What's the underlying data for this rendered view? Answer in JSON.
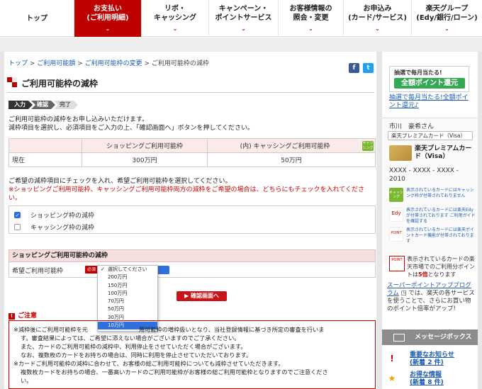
{
  "nav": {
    "items": [
      {
        "label": "トップ",
        "active": false
      },
      {
        "label": "お支払い\n(ご利用明細)",
        "active": true
      },
      {
        "label": "リボ・\nキャッシング",
        "active": false
      },
      {
        "label": "キャンペーン・\nポイントサービス",
        "active": false
      },
      {
        "label": "お客様情報の\n照会・変更",
        "active": false
      },
      {
        "label": "お申込み\n(カード/サービス)",
        "active": false
      },
      {
        "label": "楽天グループ\n(Edy/銀行/ローン)",
        "active": false
      }
    ],
    "nav_label_0": "トップ",
    "nav_label_1a": "お支払い",
    "nav_label_1b": "(ご利用明細)",
    "nav_label_2a": "リボ・",
    "nav_label_2b": "キャッシング",
    "nav_label_3a": "キャンペーン・",
    "nav_label_3b": "ポイントサービス",
    "nav_label_4a": "お客様情報の",
    "nav_label_4b": "照会・変更",
    "nav_label_5a": "お申込み",
    "nav_label_5b": "(カード/サービス)",
    "nav_label_6a": "楽天グループ",
    "nav_label_6b": "(Edy/銀行/ローン)"
  },
  "breadcrumb": {
    "items": [
      "トップ",
      "ご利用可能額",
      "ご利用可能枠の変更",
      "ご利用可能枠の減枠"
    ],
    "sep": " > "
  },
  "share": {
    "facebook": "f",
    "twitter": "t"
  },
  "page_title": "ご利用可能枠の減枠",
  "steps": [
    "入力",
    "確認",
    "完了"
  ],
  "intro": {
    "line1": "ご利用可能枠の減枠をお申し込みいただけます。",
    "line2": "減枠項目を選択し、必須項目をご入力の上、「確認画面へ」ボタンを押してください。"
  },
  "limits_table": {
    "headers": [
      "",
      "ショッピングご利用可能枠",
      "(内) キャッシングご利用可能枠"
    ],
    "cash_badge": "キャッシング",
    "rows": [
      [
        "現在",
        "300万円",
        "50万円"
      ]
    ]
  },
  "note": {
    "line1": "ご希望の減枠項目にチェックを入れ、希望ご利用可能枠を選択してください。",
    "line2": "※ショッピングご利用可能枠、キャッシングご利用可能枠両方の減枠をご希望の場合は、どちらにもチェックを入れてくださ",
    "line3": "い。"
  },
  "checkboxes": [
    {
      "label": "ショッピング枠の減枠",
      "checked": true
    },
    {
      "label": "キャッシング枠の減枠",
      "checked": false
    }
  ],
  "shopping_section": {
    "heading": "ショッピングご利用可能枠の減枠",
    "field_label": "希望ご利用可能枠",
    "required": "必須"
  },
  "dropdown": {
    "options": [
      "選択してください",
      "200万円",
      "150万円",
      "100万円",
      "70万円",
      "50万円",
      "30万円",
      "10万円"
    ],
    "checked_index": 0,
    "highlighted_index": 7
  },
  "confirm_button": "確認画面へ",
  "attention": {
    "heading": "ご注意",
    "p1a": "※減枠後にご利用可能枠を元",
    "p1b": "用可能枠の増枠扱いとなり、当社登録情報に基づき所定の審査を行いま",
    "p2": "す。審査結果によっては、ご希望に添えない場合がございますのでご了承ください。",
    "p3": "また、カードのご利用可能枠の減枠中、利用停止をさせていただく場合がございます。",
    "p4": "なお、複数枚のカードをお持ちの場合は、同時に利用を停止させていただいております。",
    "p5": "※カードご利用可能枠の減枠に合わせて、お客様の総ご利用可能枠についても減枠させていただきます。",
    "p6": "複数枚カードをお持ちの場合、一番高いカードのご利用可能枠がお客様の総ご利用可能枠となりますのでご注意くださ",
    "p7": "い。"
  },
  "sidebar": {
    "banner_top": "抽選で毎月当たる!",
    "banner_main": "全額ポイント還元",
    "banner_link": "抽選で毎月当たる!全額ポイント還元♪",
    "user_name": "市川　豪希さん",
    "card_select": "楽天プレミアムカード（Visa）",
    "card_name": "楽天プレミアムカード（Visa）",
    "card_number": "XXXX - XXXX - XXXX - 2010",
    "rows": [
      {
        "icon": "キャッシング",
        "text": "表示されているカードにはキャッシング枠が付帯されておりません"
      },
      {
        "icon": "Edy",
        "text": "表示されているカードには楽天Edyが付帯されております ご利用ガイドを確認する"
      },
      {
        "icon": "POINT",
        "text": "表示されているカードには楽天ポイントカード機能が付帯されております"
      }
    ],
    "point_text_a": "表示されているカードの楽天市場でのご利用分ポイントは",
    "point_text_b": "5倍",
    "point_text_c": "となります",
    "point_icon": "POINT",
    "sp_link": "スーパーポイントアッププログラム",
    "sp_text": "では、楽天の各サービスを使うことで、さらにお買い物のポイント倍率がアップ!",
    "message_box": "メッセージボックス",
    "messages": [
      {
        "label": "重要なお知らせ",
        "count": "(新着 2 件)"
      },
      {
        "label": "お得な情報",
        "count": "(新着 8 件)"
      }
    ]
  },
  "colors": {
    "brand_red": "#bf0000",
    "link": "#1a5ab5",
    "select_blue": "#2f6fde"
  }
}
